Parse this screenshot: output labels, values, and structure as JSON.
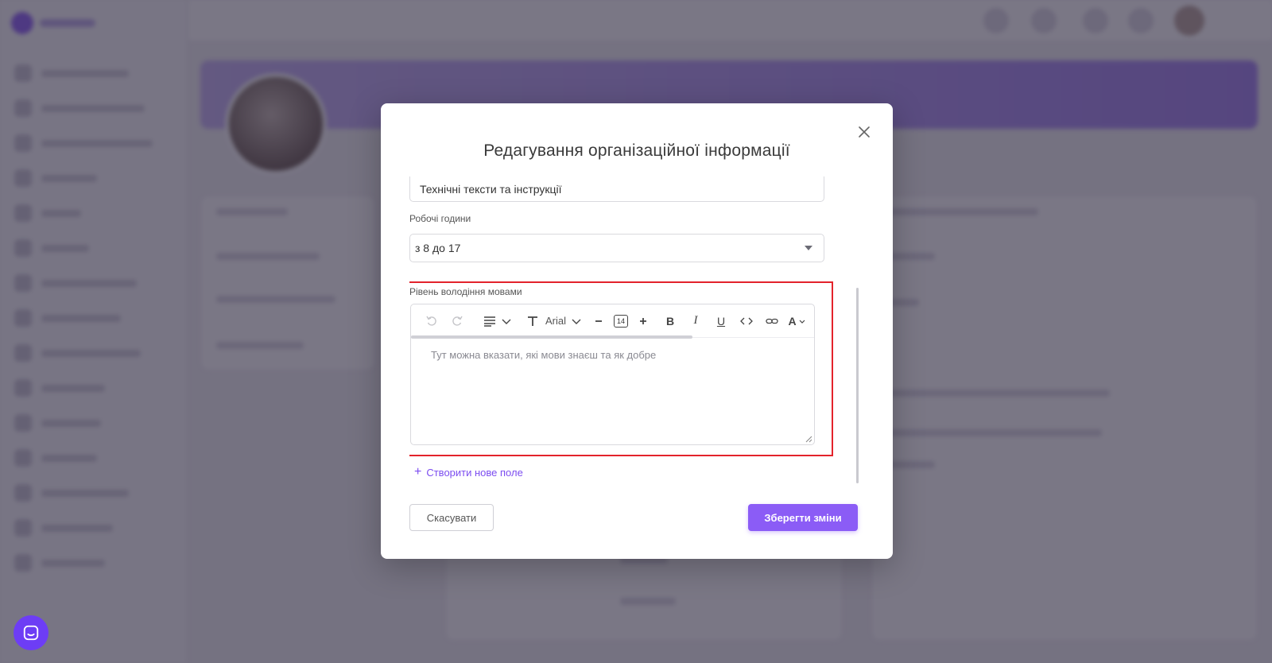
{
  "modal": {
    "title": "Редагування організаційної інформації",
    "field_top_value": "Технічні тексти та інструкції",
    "working_hours": {
      "label": "Робочі години",
      "value": "з 8 до 17"
    },
    "languages": {
      "label": "Рівень володіння мовами",
      "placeholder": "Тут можна вказати, які мови знаєш та як добре"
    },
    "toolbar": {
      "font_name": "Arial",
      "font_size": "14",
      "bold": "B",
      "italic": "I",
      "underline": "U",
      "color": "A"
    },
    "add_field_label": "Створити нове поле",
    "cancel_label": "Скасувати",
    "save_label": "Зберегти зміни"
  },
  "colors": {
    "accent": "#8b5cf6",
    "highlight": "#e3232b",
    "chat": "#6d3df5"
  }
}
